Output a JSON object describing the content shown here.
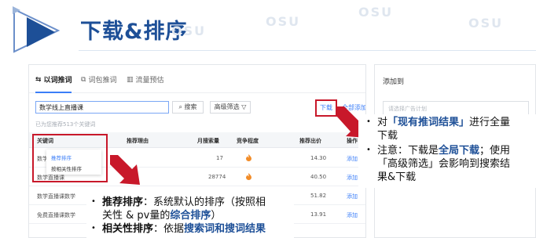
{
  "header": {
    "title": "下载&排序",
    "watermark": "OSU"
  },
  "tabs": [
    {
      "label": "以词推词",
      "icon": "swap-icon"
    },
    {
      "label": "词包推词",
      "icon": "package-icon"
    },
    {
      "label": "流量预估",
      "icon": "chart-icon"
    }
  ],
  "search": {
    "value": "数学线上直播课",
    "search_button": "搜索",
    "filter_button": "高级筛选"
  },
  "hint": "已为您推荐513个关键词",
  "download_label": "下载",
  "add_all_label": "全部添加",
  "table": {
    "headers": {
      "keyword": "关键词",
      "reason": "推荐理由",
      "monthly": "月搜索量",
      "competition": "竞争程度",
      "bid": "推荐出价",
      "action": "操作"
    },
    "rows": [
      {
        "keyword": "数学线...",
        "monthly": "17",
        "bid": "14.30",
        "action": "添加"
      },
      {
        "keyword": "数学直播课",
        "monthly": "28774",
        "bid": "40.50",
        "action": "添加"
      },
      {
        "keyword": "数学直播课数学",
        "monthly": "",
        "bid": "51.82",
        "action": "添加"
      },
      {
        "keyword": "免费直播课数学",
        "monthly": "",
        "bid": "13.91",
        "action": "添加"
      }
    ]
  },
  "sort_menu": {
    "item1": "推荐排序",
    "item2": "按相关性排序"
  },
  "right_panel": {
    "title": "添加到",
    "placeholder": "请选择广告计划"
  },
  "callout_right": {
    "b1_pre": "对",
    "b1_highlight": "「现有推词结果」",
    "b1_post1": "进行全量",
    "b1_post2": "下载",
    "b2_pre": "注意：下载是",
    "b2_highlight": "全局下载",
    "b2_post": "；使用",
    "b2_line2": "「高级筛选」会影响到搜索结",
    "b2_line3": "果&下载"
  },
  "callout_bottom": {
    "b1_bold": "推荐排序",
    "b1_text": "：系统默认的排序（按照相",
    "b1_line2_pre": "关性 & pv量的",
    "b1_line2_bold": "综合排序",
    "b1_line2_post": "）",
    "b2_bold": "相关性排序",
    "b2_text": "：依据",
    "b2_highlight": "搜索词和搜词结果"
  },
  "colors": {
    "title": "#1d4f97",
    "accent_red": "#c8182a",
    "link_blue": "#3b7ef8",
    "flame": "#f28c28"
  }
}
